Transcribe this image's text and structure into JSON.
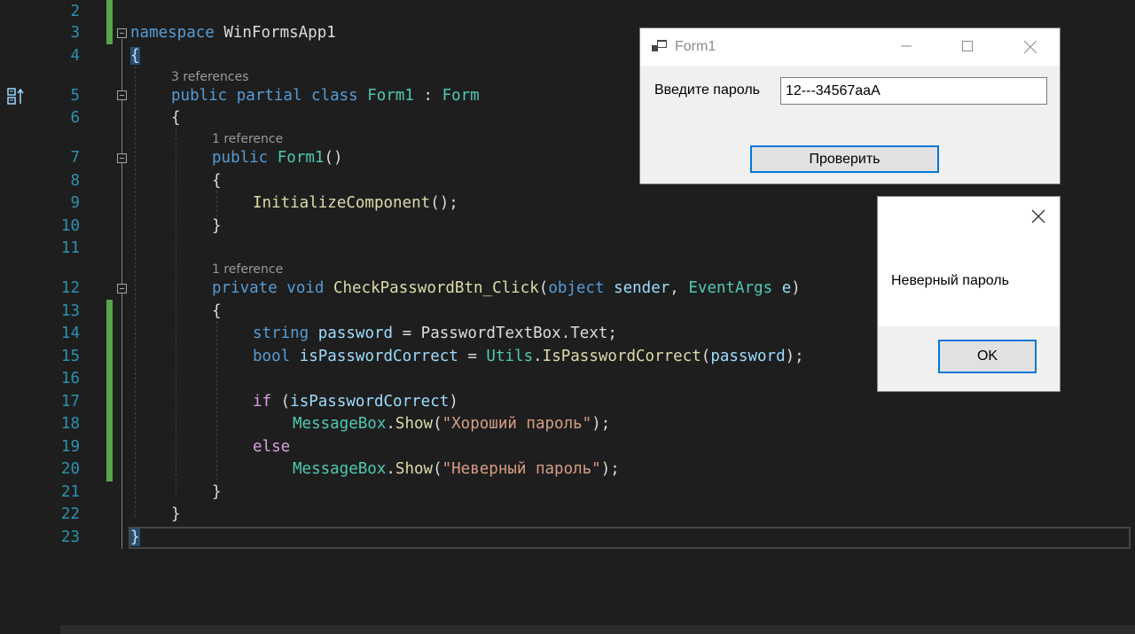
{
  "editor": {
    "line_numbers": [
      "2",
      "3",
      "4",
      "5",
      "6",
      "7",
      "8",
      "9",
      "10",
      "11",
      "12",
      "13",
      "14",
      "15",
      "16",
      "17",
      "18",
      "19",
      "20",
      "21",
      "22",
      "23"
    ],
    "refs": {
      "class_refs": "3 references",
      "ctor_refs": "1 reference",
      "method_refs": "1 reference"
    },
    "code": {
      "ns_kw": "namespace",
      "ns_name": " WinFormsApp1",
      "open_brace": "{",
      "close_brace": "}",
      "class_kw": "public partial class ",
      "class_name": "Form1",
      "class_colon": " : ",
      "class_base": "Form",
      "ctor_kw": "public ",
      "ctor_name": "Form1",
      "ctor_parens": "()",
      "init_call": "InitializeComponent",
      "init_tail": "();",
      "m_kw": "private void ",
      "m_name": "CheckPasswordBtn_Click",
      "m_open": "(",
      "m_obj": "object",
      "m_sender": " sender",
      "m_comma": ", ",
      "m_evtype": "EventArgs",
      "m_e": " e",
      "m_close": ")",
      "l14_kw": "string ",
      "l14_var": "password",
      "l14_eq": " = ",
      "l14_src": "PasswordTextBox",
      "l14_dot": ".",
      "l14_prop": "Text",
      "l14_end": ";",
      "l15_kw": "bool ",
      "l15_var": "isPasswordCorrect",
      "l15_eq": " = ",
      "l15_cls": "Utils",
      "l15_dot": ".",
      "l15_meth": "IsPasswordCorrect",
      "l15_open": "(",
      "l15_arg": "password",
      "l15_end": ");",
      "l17_kw": "if",
      "l17_open": " (",
      "l17_var": "isPasswordCorrect",
      "l17_close": ")",
      "l18_cls": "MessageBox",
      "l18_dot": ".",
      "l18_meth": "Show",
      "l18_open": "(",
      "l18_str": "\"Хороший пароль\"",
      "l18_end": ");",
      "l19_kw": "else",
      "l20_cls": "MessageBox",
      "l20_dot": ".",
      "l20_meth": "Show",
      "l20_open": "(",
      "l20_str": "\"Неверный пароль\"",
      "l20_end": ");"
    }
  },
  "form1": {
    "title": "Form1",
    "password_label": "Введите пароль",
    "password_value": "12---34567aaA",
    "check_button": "Проверить"
  },
  "messagebox": {
    "message": "Неверный пароль",
    "ok_button": "OK"
  },
  "colors": {
    "editor_bg": "#1e1e1e",
    "keyword": "#569cd6",
    "control_keyword": "#d8a0df",
    "type": "#4ec9b0",
    "method": "#dcdcaa",
    "parameter": "#9cdcfe",
    "string": "#d69d85",
    "line_number": "#2b91af",
    "change_bar": "#57a64a",
    "button_focus": "#0078d7"
  }
}
